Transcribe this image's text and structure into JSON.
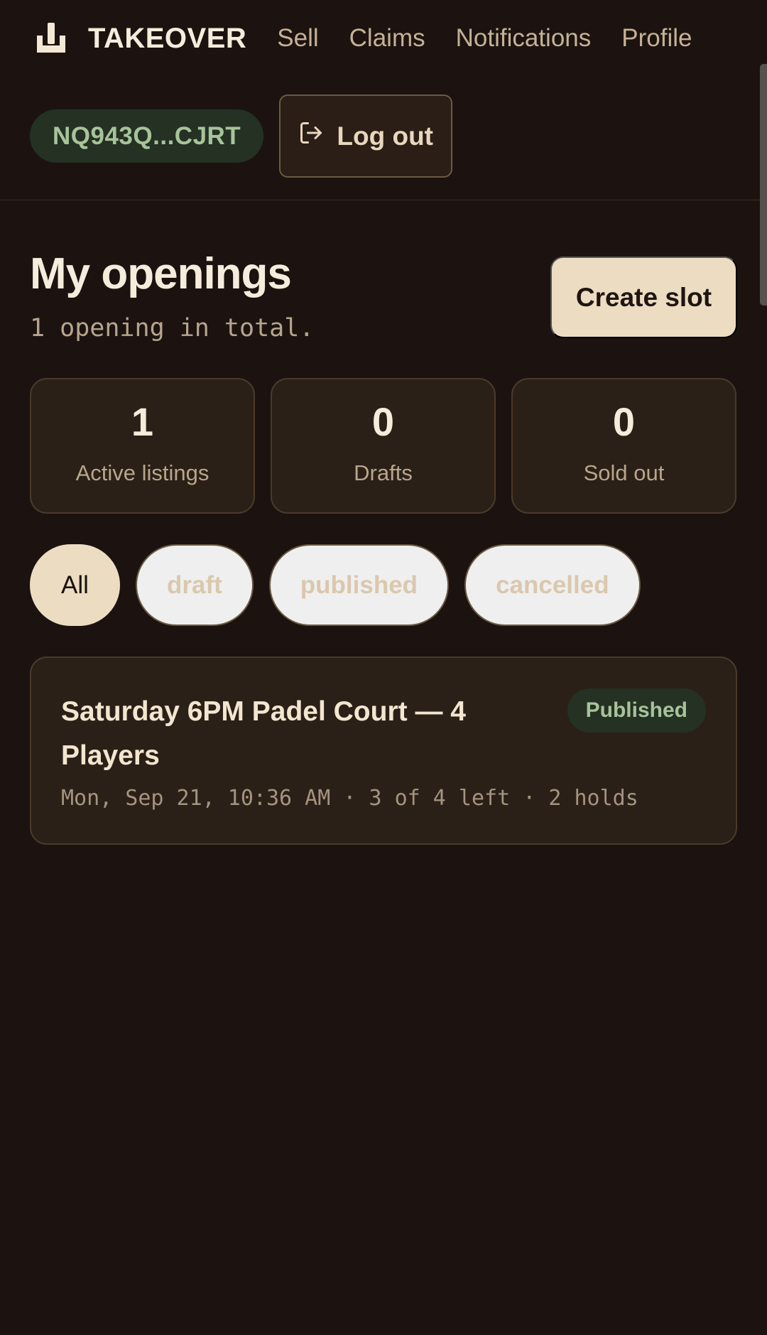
{
  "nav": {
    "brand": "TAKEOVER",
    "links": [
      "Sell",
      "Claims",
      "Notifications",
      "Profile"
    ]
  },
  "user": {
    "wallet": "NQ943Q...CJRT",
    "logout_label": "Log out"
  },
  "page": {
    "title": "My openings",
    "subtitle": "1 opening in total.",
    "create_label": "Create slot"
  },
  "stats": [
    {
      "value": "1",
      "label": "Active listings"
    },
    {
      "value": "0",
      "label": "Drafts"
    },
    {
      "value": "0",
      "label": "Sold out"
    }
  ],
  "filters": {
    "options": [
      "All",
      "draft",
      "published",
      "cancelled"
    ],
    "selected": "All"
  },
  "listings": [
    {
      "title": "Saturday 6PM Padel Court — 4 Players",
      "status": "Published",
      "meta": "Mon, Sep 21, 10:36 AM · 3 of 4 left · 2 holds"
    }
  ],
  "colors": {
    "background": "#1c1310",
    "card": "#2b2017",
    "accent": "#ecdcc2",
    "success_bg": "#243123",
    "success_text": "#a7c39a"
  },
  "icons": {
    "logo": "hand-ticket-icon",
    "logout": "logout-icon"
  }
}
